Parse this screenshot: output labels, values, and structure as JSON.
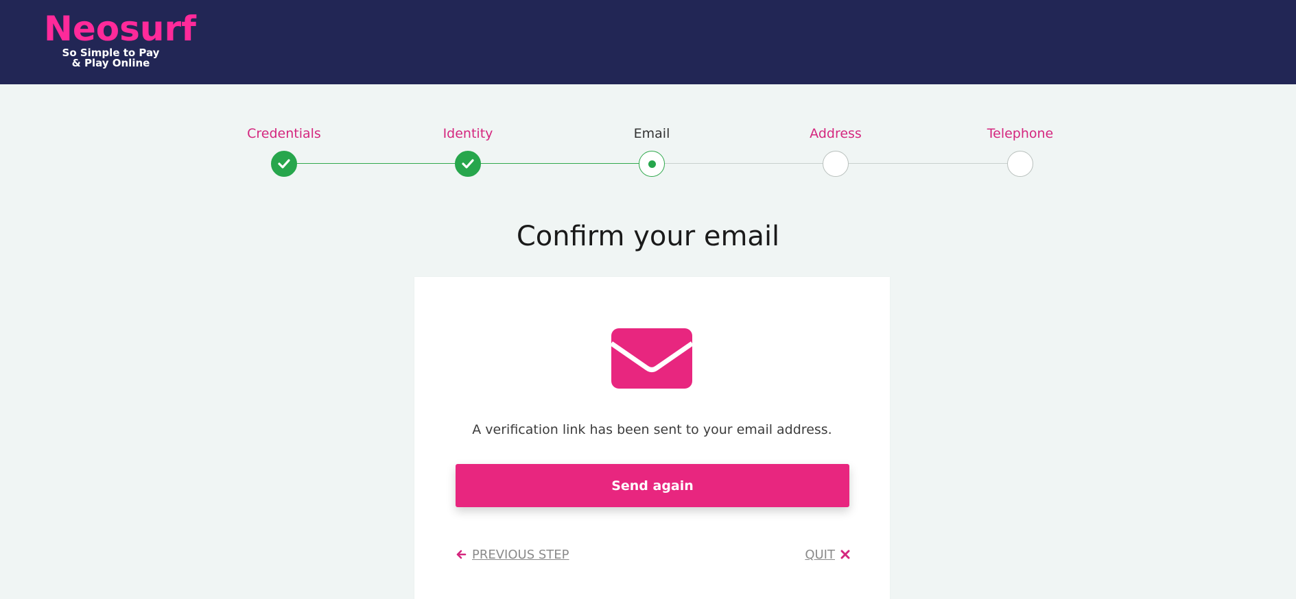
{
  "header": {
    "logo_word": "Neosurf",
    "logo_tagline_1": "So Simple to Pay",
    "logo_tagline_2": "& Play Online",
    "background_color": "#222655",
    "logo_color": "#ff2a9a"
  },
  "stepper": {
    "steps": [
      {
        "label": "Credentials",
        "status": "done"
      },
      {
        "label": "Identity",
        "status": "done"
      },
      {
        "label": "Email",
        "status": "current"
      },
      {
        "label": "Address",
        "status": "pending"
      },
      {
        "label": "Telephone",
        "status": "pending"
      }
    ],
    "done_color": "#27a64c",
    "label_color": "#d4267e"
  },
  "main": {
    "title": "Confirm your email",
    "icon": "envelope-icon",
    "message": "A verification link has been sent to your email address.",
    "send_again_label": "Send again",
    "previous_step_label": "PREVIOUS STEP",
    "quit_label": "QUIT",
    "accent_color": "#e8267f"
  }
}
